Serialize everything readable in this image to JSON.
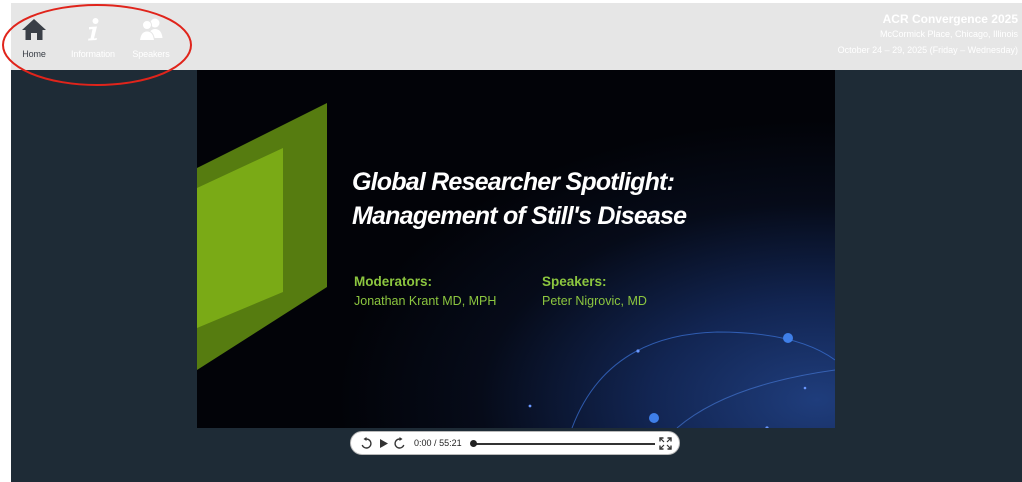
{
  "nav": {
    "items": [
      {
        "label": "Home",
        "icon": "home-icon",
        "active": true
      },
      {
        "label": "Information",
        "icon": "info-icon",
        "active": false
      },
      {
        "label": "Speakers",
        "icon": "speakers-icon",
        "active": false
      }
    ]
  },
  "event": {
    "title": "ACR Convergence 2025",
    "venue": "McCormick Place, Chicago, Illinois",
    "dates": "October 24 – 29, 2025 (Friday – Wednesday)"
  },
  "slide": {
    "title_line1": "Global Researcher Spotlight:",
    "title_line2": "Management of Still's Disease",
    "moderators_heading": "Moderators:",
    "moderators_name": "Jonathan Krant MD, MPH",
    "speakers_heading": "Speakers:",
    "speakers_name": "Peter Nigrovic, MD"
  },
  "player": {
    "current_time": "0:00",
    "separator": "/",
    "duration": "55:21",
    "progress_fraction": 0
  },
  "colors": {
    "frame_bg": "#1e2b36",
    "topbar_bg": "#e6e6e6",
    "accent_green": "#8cc63f",
    "annotation_red": "#e0241b",
    "home_icon": "#3a3f47"
  }
}
